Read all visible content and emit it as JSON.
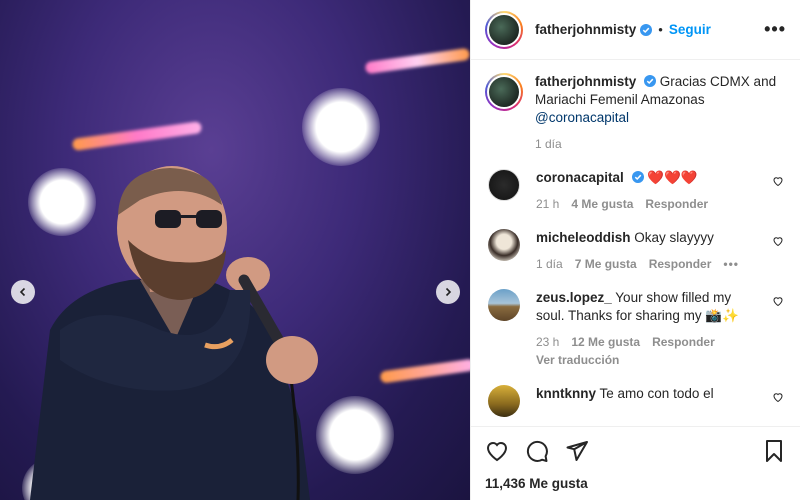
{
  "post": {
    "username": "fatherjohnmisty",
    "follow_label": "Seguir",
    "separator": "•",
    "more_label": "•••",
    "caption": {
      "username": "fatherjohnmisty",
      "text": "Gracias CDMX and Mariachi Femenil Amazonas",
      "mention": "@coronacapital",
      "time": "1 día"
    },
    "likes_label": "11,436 Me gusta"
  },
  "comments": [
    {
      "username": "coronacapital",
      "verified": true,
      "text": "❤️❤️❤️",
      "time": "21 h",
      "likes": "4 Me gusta",
      "reply": "Responder",
      "more": "",
      "see_translation": ""
    },
    {
      "username": "micheleoddish",
      "verified": false,
      "text": "Okay slayyyy",
      "time": "1 día",
      "likes": "7 Me gusta",
      "reply": "Responder",
      "more": "•••",
      "see_translation": ""
    },
    {
      "username": "zeus.lopez_",
      "verified": false,
      "text": "Your show filled my soul. Thanks for sharing my 📸✨",
      "time": "23 h",
      "likes": "12 Me gusta",
      "reply": "Responder",
      "more": "",
      "see_translation": "Ver traducción"
    },
    {
      "username": "knntknny",
      "verified": false,
      "text": "Te amo con todo el",
      "time": "",
      "likes": "",
      "reply": "",
      "more": "",
      "see_translation": ""
    }
  ],
  "icons": {
    "verified": "verified-badge-icon",
    "like": "heart-icon",
    "comment": "comment-bubble-icon",
    "share": "paper-plane-icon",
    "save": "bookmark-icon",
    "prev": "chevron-left-icon",
    "next": "chevron-right-icon"
  },
  "colors": {
    "accent": "#0095f6",
    "verified": "#3897f0",
    "mention": "#00376b",
    "secondary_text": "#8e8e8e",
    "stage_purple": "#3d2a78"
  }
}
